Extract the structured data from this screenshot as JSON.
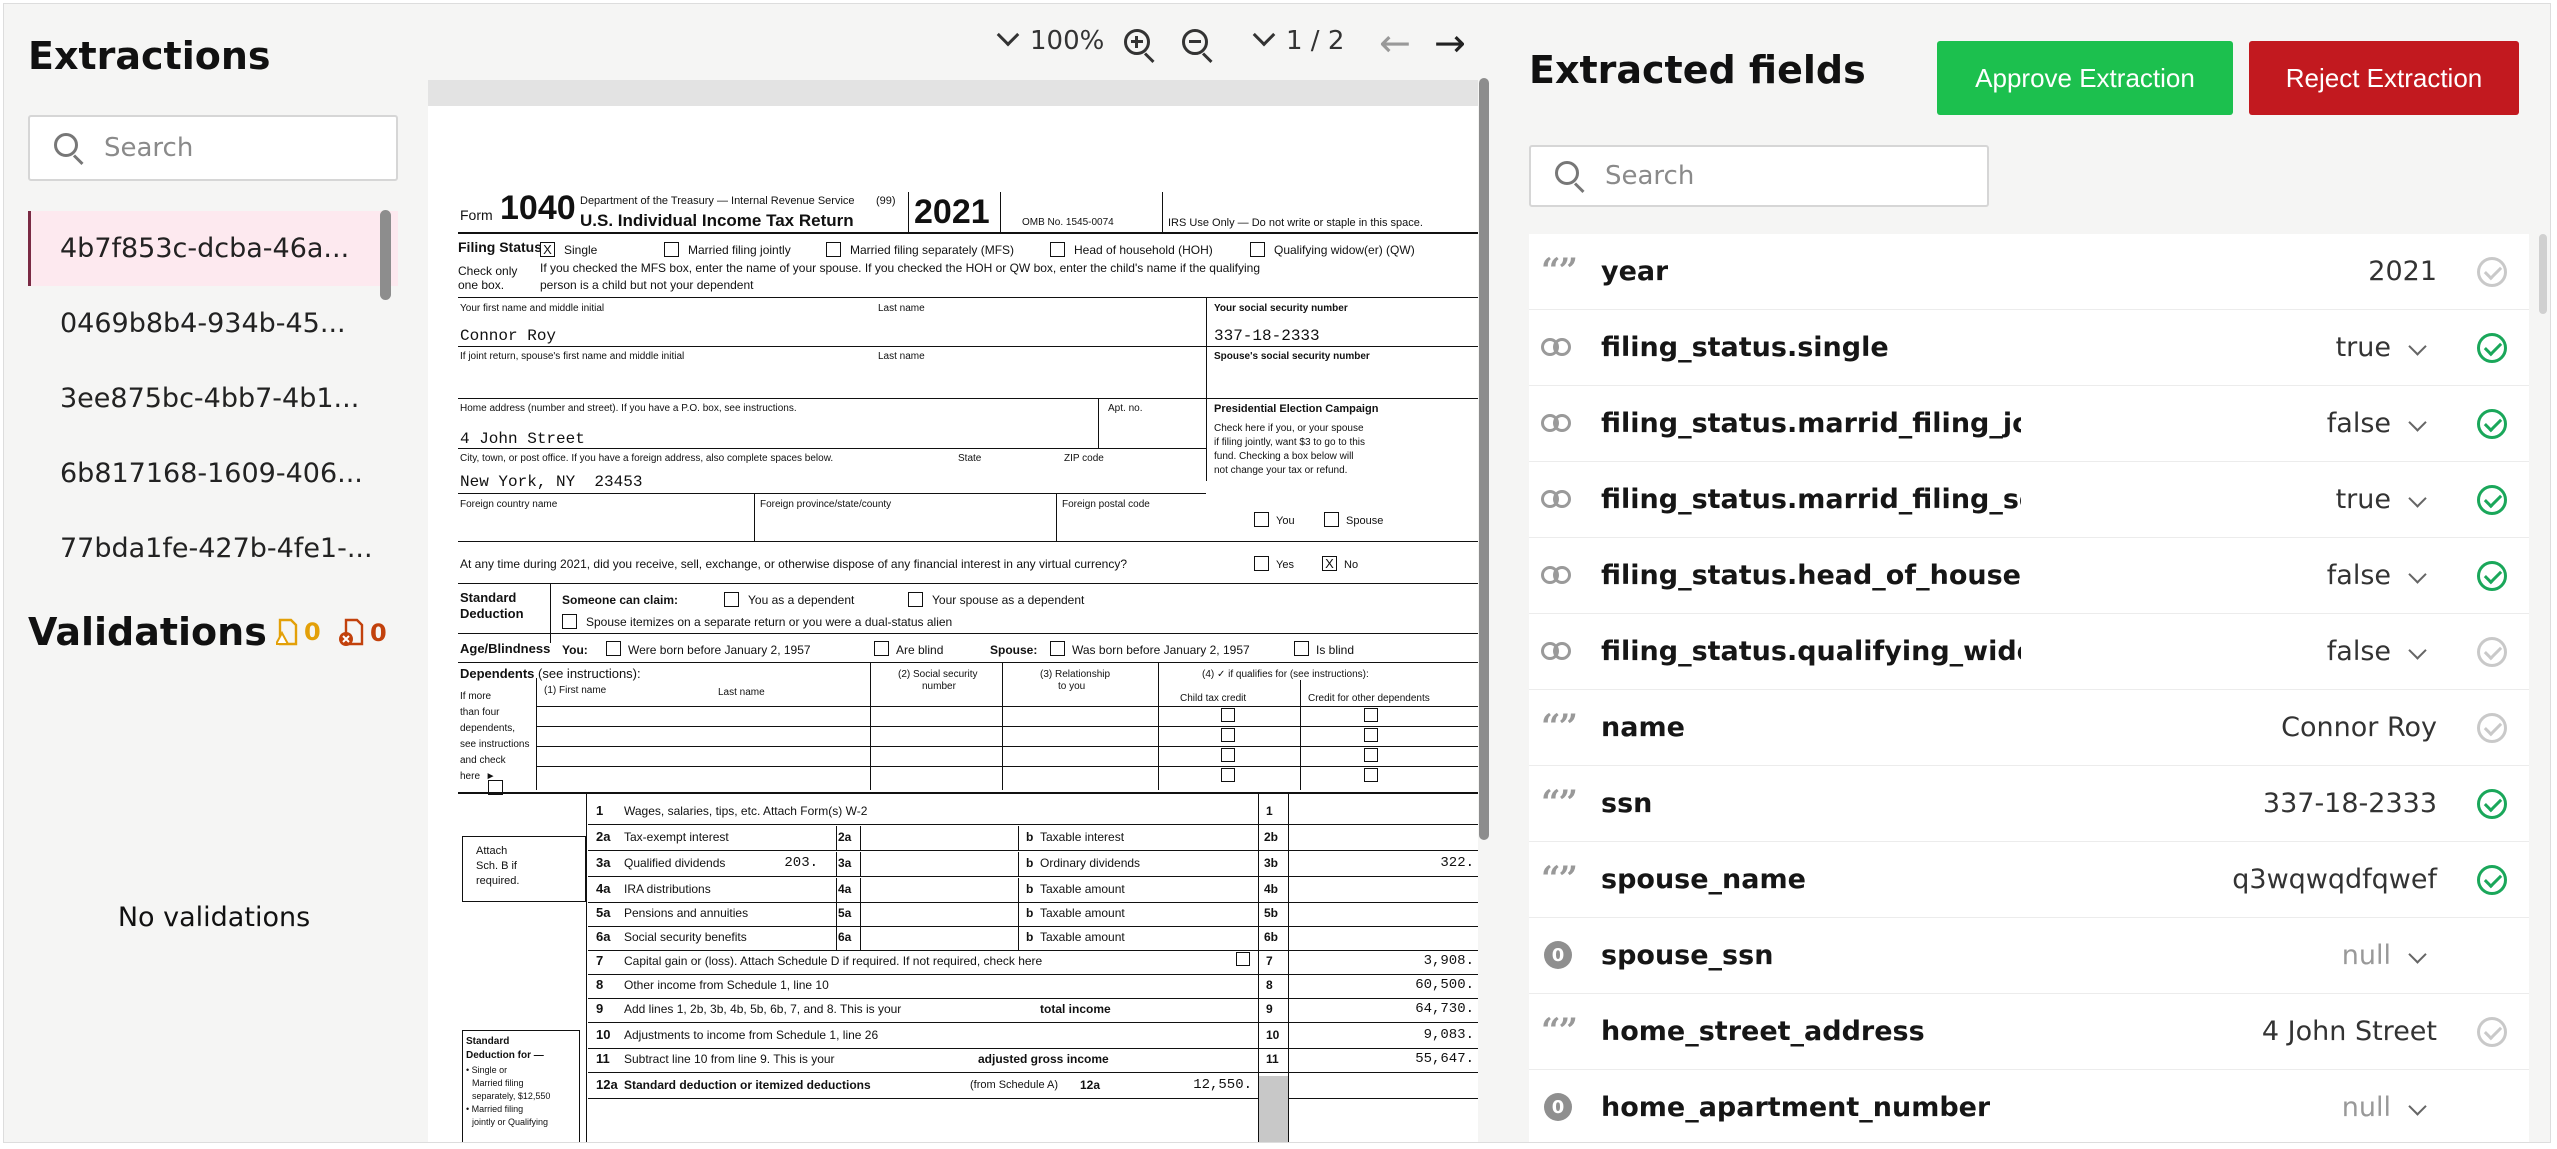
{
  "sidebar": {
    "extractions_title": "Extractions",
    "search_placeholder": "Search",
    "extractions": [
      "4b7f853c-dcba-46a...",
      "0469b8b4-934b-45...",
      "3ee875bc-4bb7-4b1...",
      "6b817168-1609-406...",
      "77bda1fe-427b-4fe1-..."
    ],
    "selected_index": 0,
    "validations_title": "Validations",
    "warning_count": "0",
    "error_count": "0",
    "no_validations": "No validations"
  },
  "viewer": {
    "zoom": "100%",
    "page": "1 / 2"
  },
  "document": {
    "form_label": "Form",
    "form_number": "1040",
    "dept": "Department of the Treasury — Internal Revenue Service",
    "code99": "(99)",
    "title": "U.S. Individual Income Tax Return",
    "year": "2021",
    "omb": "OMB No. 1545-0074",
    "irs_use": "IRS Use Only — Do not write or staple in this space.",
    "filing_status": "Filing Status",
    "check_only": "Check only",
    "one_box": "one box.",
    "fs_single": "Single",
    "fs_mfj": "Married filing jointly",
    "fs_mfs": "Married filing separately (MFS)",
    "fs_hoh": "Head of household (HOH)",
    "fs_qw": "Qualifying widow(er) (QW)",
    "fs_note1": "If you checked the MFS box, enter the name of your spouse. If you checked the HOH or QW box, enter the child's name if the qualifying",
    "fs_note2": "person is a child but not your dependent",
    "first_name_label": "Your first name and middle initial",
    "last_name_label": "Last name",
    "ssn_label": "Your social security number",
    "name_value": "Connor Roy",
    "ssn_value": "337-18-2333",
    "spouse_name_label": "If joint return, spouse's first name and middle initial",
    "spouse_last_label": "Last name",
    "spouse_ssn_label": "Spouse's social security number",
    "home_label": "Home address (number and street). If you have a P.O. box, see instructions.",
    "apt_label": "Apt. no.",
    "pec_title": "Presidential Election Campaign",
    "pec_text1": "Check here if you, or your spouse",
    "pec_text2": "if filing jointly, want $3 to go to this",
    "pec_text3": "fund. Checking a  box below will",
    "pec_text4": "not change your tax or refund.",
    "pec_you": "You",
    "pec_spouse": "Spouse",
    "street_value": "4 John Street",
    "city_label": "City, town, or post office. If you have a foreign address, also complete spaces below.",
    "state_label": "State",
    "zip_label": "ZIP code",
    "city_value": "New York, NY",
    "zip_value": "23453",
    "foreign_country": "Foreign country name",
    "foreign_province": "Foreign province/state/county",
    "foreign_postal": "Foreign postal code",
    "virtual_q": "At any time during 2021, did you receive, sell, exchange, or otherwise dispose of any financial interest in any virtual currency?",
    "yes": "Yes",
    "no": "No",
    "std_ded": "Standard",
    "std_ded2": "Deduction",
    "someone_claim": "Someone can claim:",
    "you_dep": "You as a dependent",
    "spouse_dep": "Your spouse as a dependent",
    "spouse_itemizes": "Spouse itemizes on a separate return or you were a dual-status alien",
    "age_blind": "Age/Blindness",
    "you_label": "You:",
    "born_before": "Were born before January 2, 1957",
    "are_blind": "Are blind",
    "spouse_label": "Spouse:",
    "was_born": "Was born before January 2, 1957",
    "is_blind": "Is blind",
    "dependents": "Dependents",
    "see_instr": "(see instructions):",
    "dep_first": "(1) First name",
    "dep_last": "Last name",
    "dep_ssn_a": "(2) Social security",
    "dep_ssn_b": "number",
    "dep_rel_a": "(3) Relationship",
    "dep_rel_b": "to you",
    "dep_qual": "(4) ✓ if qualifies for (see instructions):",
    "child_credit": "Child tax credit",
    "other_credit": "Credit for other dependents",
    "more_than": [
      "If more",
      "than four",
      "dependents,",
      "see instructions",
      "and check",
      "here  ►"
    ],
    "attach_a": "Attach",
    "attach_b": "Sch. B if",
    "attach_c": "required.",
    "lines": [
      {
        "no": "1",
        "label": "Wages, salaries, tips, etc. Attach Form(s) W-2"
      },
      {
        "no": "2a",
        "label": "Tax-exempt interest"
      },
      {
        "no": "3a",
        "label": "Qualified dividends"
      },
      {
        "no": "4a",
        "label": "IRA distributions"
      },
      {
        "no": "5a",
        "label": "Pensions and annuities"
      },
      {
        "no": "6a",
        "label": "Social security benefits"
      },
      {
        "no": "7",
        "label": "Capital gain or (loss). Attach Schedule D if required. If not required, check here"
      },
      {
        "no": "8",
        "label": "Other income from Schedule 1, line 10"
      },
      {
        "no": "9",
        "label": "Add lines 1, 2b, 3b, 4b, 5b, 6b, 7, and 8. This is your"
      },
      {
        "no": "10",
        "label": "Adjustments to income from Schedule 1, line 26"
      },
      {
        "no": "11",
        "label": "Subtract line 10 from line 9. This is your"
      },
      {
        "no": "12a",
        "label": "Standard deduction or itemized deductions"
      }
    ],
    "total_income": "total income",
    "agi": "adjusted gross income",
    "from_sched_a": "(from Schedule A)",
    "b_taxable_interest": "Taxable interest",
    "b_ordinary_div": "Ordinary dividends",
    "b_taxable_amount": "Taxable amount",
    "box_2b": "2b",
    "box_3b": "3b",
    "box_4b": "4b",
    "box_5b": "5b",
    "box_6b": "6b",
    "b_letter": "b",
    "val_3a": "203.",
    "val_3b": "322.",
    "val_7": "3,908.",
    "val_8": "60,500.",
    "val_9": "64,730.",
    "val_10": "9,083.",
    "val_11": "55,647.",
    "val_12a": "12,550.",
    "std_for": "Standard",
    "std_for2": "Deduction for —",
    "std_single": "• Single or",
    "std_mfs": "Married filing",
    "std_mfs2": "separately, $12,550",
    "std_mfj": "• Married filing",
    "std_mfj2": "jointly or Qualifying"
  },
  "fields_panel": {
    "title": "Extracted fields",
    "approve": "Approve Extraction",
    "reject": "Reject Extraction",
    "search_placeholder": "Search",
    "fields": [
      {
        "icon": "quote-icon",
        "name": "year",
        "value": "2021",
        "dropdown": false,
        "status": "unverified"
      },
      {
        "icon": "boolean-icon",
        "name": "filing_status.single",
        "value": "true",
        "dropdown": true,
        "status": "verified"
      },
      {
        "icon": "boolean-icon",
        "name": "filing_status.marrid_filing_join...",
        "value": "false",
        "dropdown": true,
        "status": "verified"
      },
      {
        "icon": "boolean-icon",
        "name": "filing_status.marrid_filing_sep...",
        "value": "true",
        "dropdown": true,
        "status": "verified"
      },
      {
        "icon": "boolean-icon",
        "name": "filing_status.head_of_househ...",
        "value": "false",
        "dropdown": true,
        "status": "verified"
      },
      {
        "icon": "boolean-icon",
        "name": "filing_status.qualifying_widow",
        "value": "false",
        "dropdown": true,
        "status": "unverified"
      },
      {
        "icon": "quote-icon",
        "name": "name",
        "value": "Connor Roy",
        "dropdown": false,
        "status": "unverified"
      },
      {
        "icon": "quote-icon",
        "name": "ssn",
        "value": "337-18-2333",
        "dropdown": false,
        "status": "verified"
      },
      {
        "icon": "quote-icon",
        "name": "spouse_name",
        "value": "q3wqwqdfqwef",
        "dropdown": false,
        "status": "verified"
      },
      {
        "icon": "null-icon",
        "name": "spouse_ssn",
        "value": "null",
        "dropdown": true,
        "status": "none"
      },
      {
        "icon": "quote-icon",
        "name": "home_street_address",
        "value": "4 John Street",
        "dropdown": false,
        "status": "unverified"
      },
      {
        "icon": "null-icon",
        "name": "home_apartment_number",
        "value": "null",
        "dropdown": true,
        "status": "none"
      }
    ]
  },
  "colors": {
    "approve": "#1cc04e",
    "reject": "#c2191f",
    "selected_row": "#fde9ef",
    "verified": "#1aa75a",
    "warning": "#e3a008",
    "error": "#c2410c"
  }
}
